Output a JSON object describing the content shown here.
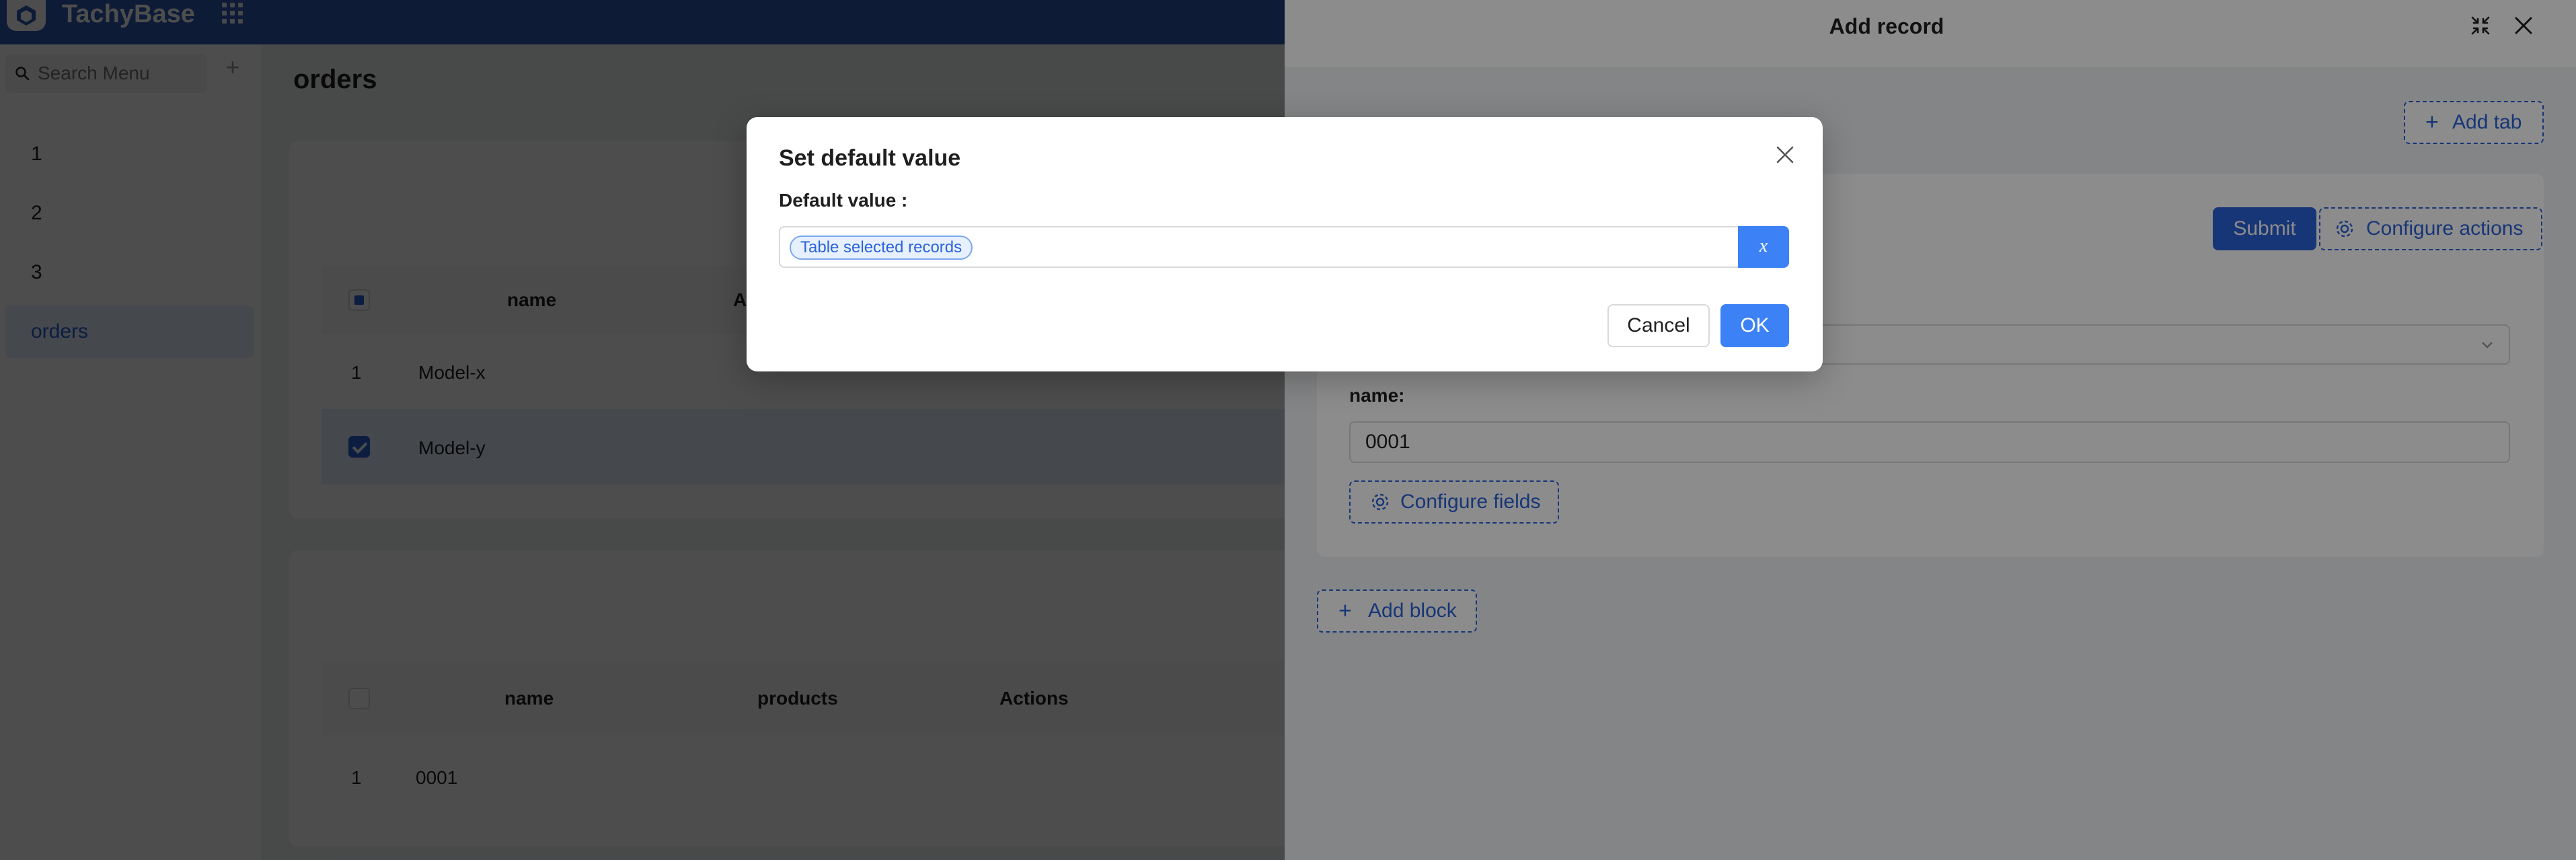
{
  "header": {
    "brand": "TachyBase"
  },
  "sidebar": {
    "search_placeholder": "Search Menu",
    "items": [
      {
        "label": "1"
      },
      {
        "label": "2"
      },
      {
        "label": "3"
      },
      {
        "label": "orders"
      }
    ]
  },
  "page": {
    "title": "orders",
    "table1": {
      "headers": [
        "name",
        "A"
      ],
      "rows": [
        {
          "index": "1",
          "name": "Model-x",
          "selected": false
        },
        {
          "index": "",
          "name": "Model-y",
          "selected": true
        }
      ]
    },
    "table2": {
      "headers": [
        "name",
        "products",
        "Actions"
      ],
      "rows": [
        {
          "index": "1",
          "name": "0001"
        }
      ]
    }
  },
  "drawer": {
    "title": "Add record",
    "add_tab_label": "Add tab",
    "submit_label": "Submit",
    "configure_actions_label": "Configure actions",
    "name_label": "name",
    "name_value": "0001",
    "configure_fields_label": "Configure fields",
    "add_block_label": "Add block"
  },
  "modal": {
    "title": "Set default value",
    "field_label": "Default value",
    "variable_tag": "Table selected records",
    "variable_button": "x",
    "cancel_label": "Cancel",
    "ok_label": "OK"
  },
  "colors": {
    "header_bg": "#2d5cb8",
    "primary": "#2b63d9",
    "button_blue": "#3c82f6"
  }
}
